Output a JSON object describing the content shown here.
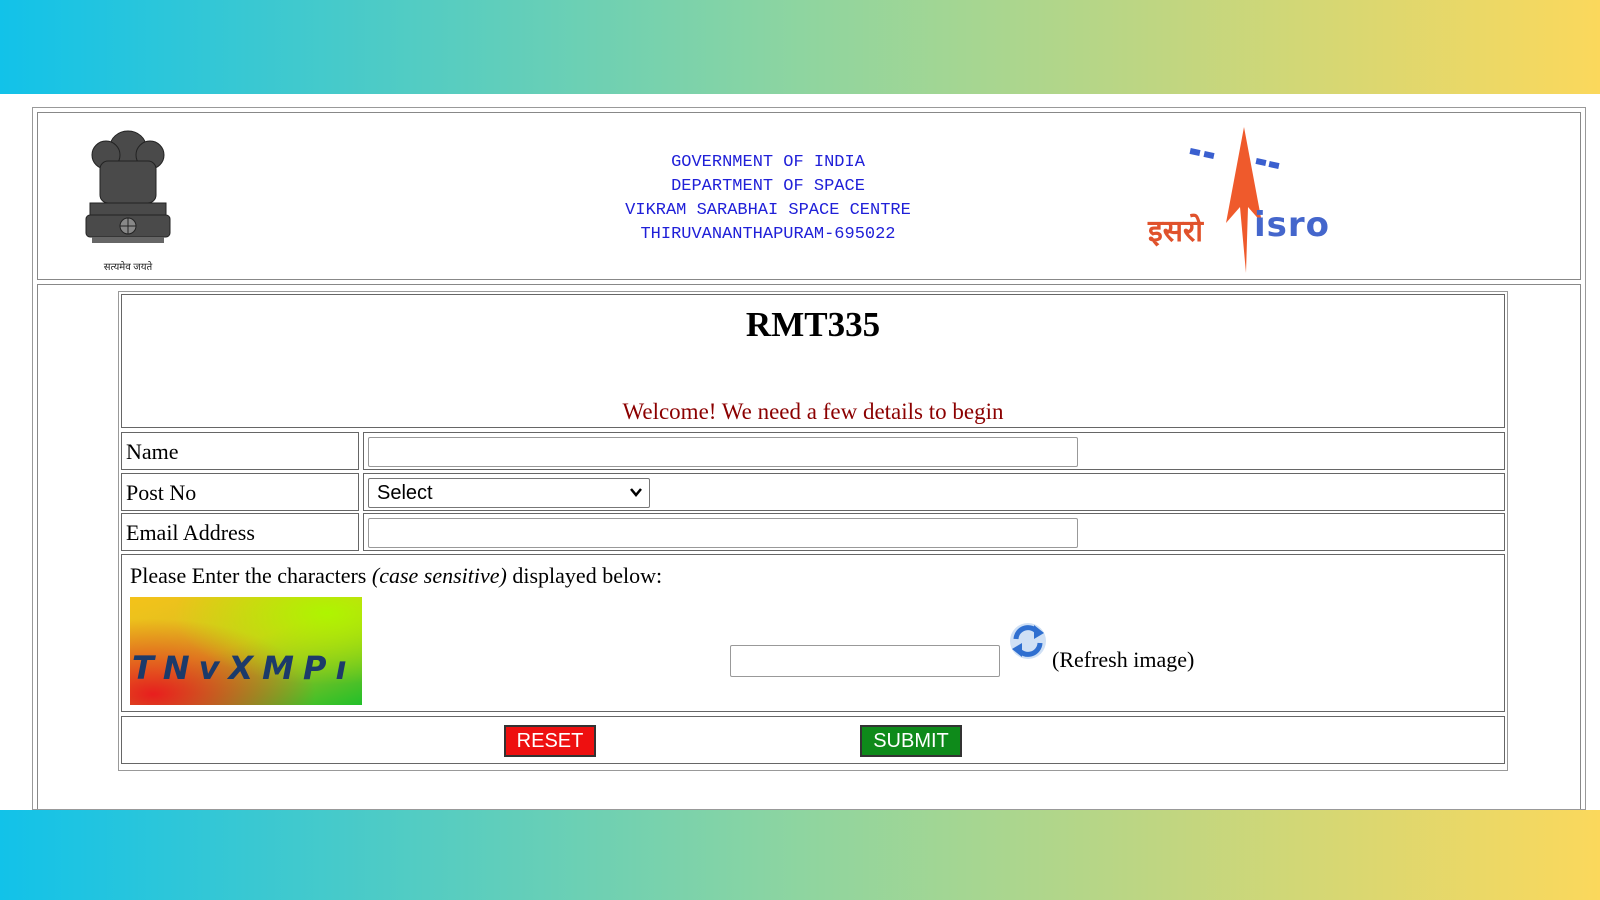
{
  "header": {
    "emblem_caption": "सत्यमेव जयते",
    "lines": [
      "GOVERNMENT OF INDIA",
      "DEPARTMENT OF SPACE",
      "VIKRAM SARABHAI SPACE CENTRE",
      "THIRUVANANTHAPURAM-695022"
    ],
    "logo_hindi": "इसरो",
    "logo_english": "isro"
  },
  "form": {
    "title": "RMT335",
    "welcome": "Welcome! We need a few details to begin",
    "fields": {
      "name_label": "Name",
      "name_value": "",
      "post_label": "Post No",
      "post_selected": "Select",
      "email_label": "Email Address",
      "email_value": ""
    },
    "captcha": {
      "instruction_before": "Please Enter the characters ",
      "instruction_emphasis": "(case sensitive)",
      "instruction_after": " displayed below:",
      "code": "TNvXMPı",
      "input_value": "",
      "refresh_label": "(Refresh image)"
    },
    "buttons": {
      "reset": "RESET",
      "submit": "SUBMIT"
    }
  },
  "colors": {
    "header_text": "#2020d8",
    "welcome_text": "#8b0000",
    "reset_bg": "#ee1010",
    "submit_bg": "#0e8a1a",
    "band_gradient": [
      "#12c2e9",
      "#8ed5a0",
      "#fbd85c"
    ]
  },
  "icons": [
    "national-emblem-icon",
    "isro-logo-icon",
    "refresh-icon",
    "dropdown-arrow-icon"
  ]
}
